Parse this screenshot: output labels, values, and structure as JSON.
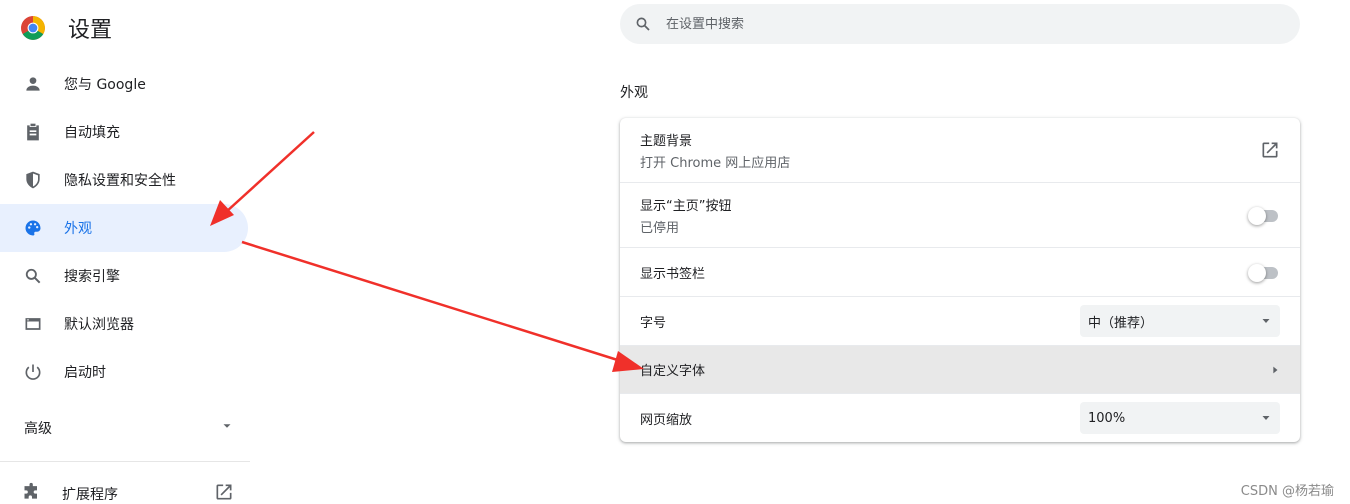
{
  "app": {
    "title": "设置"
  },
  "sidebar": {
    "items": [
      {
        "label": "您与 Google",
        "icon": "person-icon",
        "active": false
      },
      {
        "label": "自动填充",
        "icon": "clipboard-icon",
        "active": false
      },
      {
        "label": "隐私设置和安全性",
        "icon": "shield-icon",
        "active": false
      },
      {
        "label": "外观",
        "icon": "palette-icon",
        "active": true
      },
      {
        "label": "搜索引擎",
        "icon": "search-icon",
        "active": false
      },
      {
        "label": "默认浏览器",
        "icon": "browser-icon",
        "active": false
      },
      {
        "label": "启动时",
        "icon": "power-icon",
        "active": false
      }
    ],
    "advanced_label": "高级",
    "extensions_label": "扩展程序"
  },
  "search": {
    "placeholder": "在设置中搜索"
  },
  "section": {
    "title": "外观"
  },
  "card": {
    "theme_title": "主题背景",
    "theme_subtitle": "打开 Chrome 网上应用店",
    "home_button_title": "显示“主页”按钮",
    "home_button_status": "已停用",
    "bookmarks_bar_title": "显示书签栏",
    "font_size_title": "字号",
    "font_size_value": "中（推荐）",
    "custom_fonts_title": "自定义字体",
    "zoom_title": "网页缩放",
    "zoom_value": "100%"
  },
  "colors": {
    "accent": "#1a73e8",
    "active_bg": "#e8f0fe",
    "arrow": "#f0302a"
  },
  "watermark": "CSDN @杨若瑜"
}
